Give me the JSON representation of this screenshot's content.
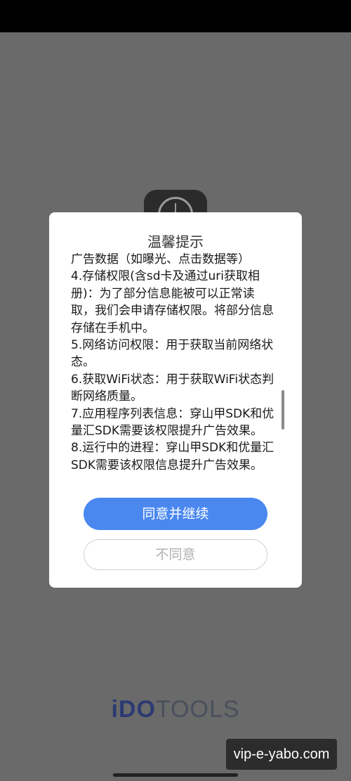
{
  "dialog": {
    "title": "温馨提示",
    "paragraphs": [
      "广告数据（如曝光、点击数据等）",
      "4.存储权限(含sd卡及通过uri获取相册)：为了部分信息能被可以正常读取，我们会申请存储权限。将部分信息存储在手机中。",
      "5.网络访问权限：用于获取当前网络状态。",
      "6.获取WiFi状态：用于获取WiFi状态判断网络质量。",
      "7.应用程序列表信息：穿山甲SDK和优量汇SDK需要该权限提升广告效果。",
      "8.运行中的进程：穿山甲SDK和优量汇SDK需要该权限信息提升广告效果。"
    ],
    "agree_label": "同意并继续",
    "disagree_label": "不同意"
  },
  "background": {
    "logo_part1": "iDO",
    "logo_part2": "TOOLS"
  },
  "watermark": "vip-e-yabo.com"
}
